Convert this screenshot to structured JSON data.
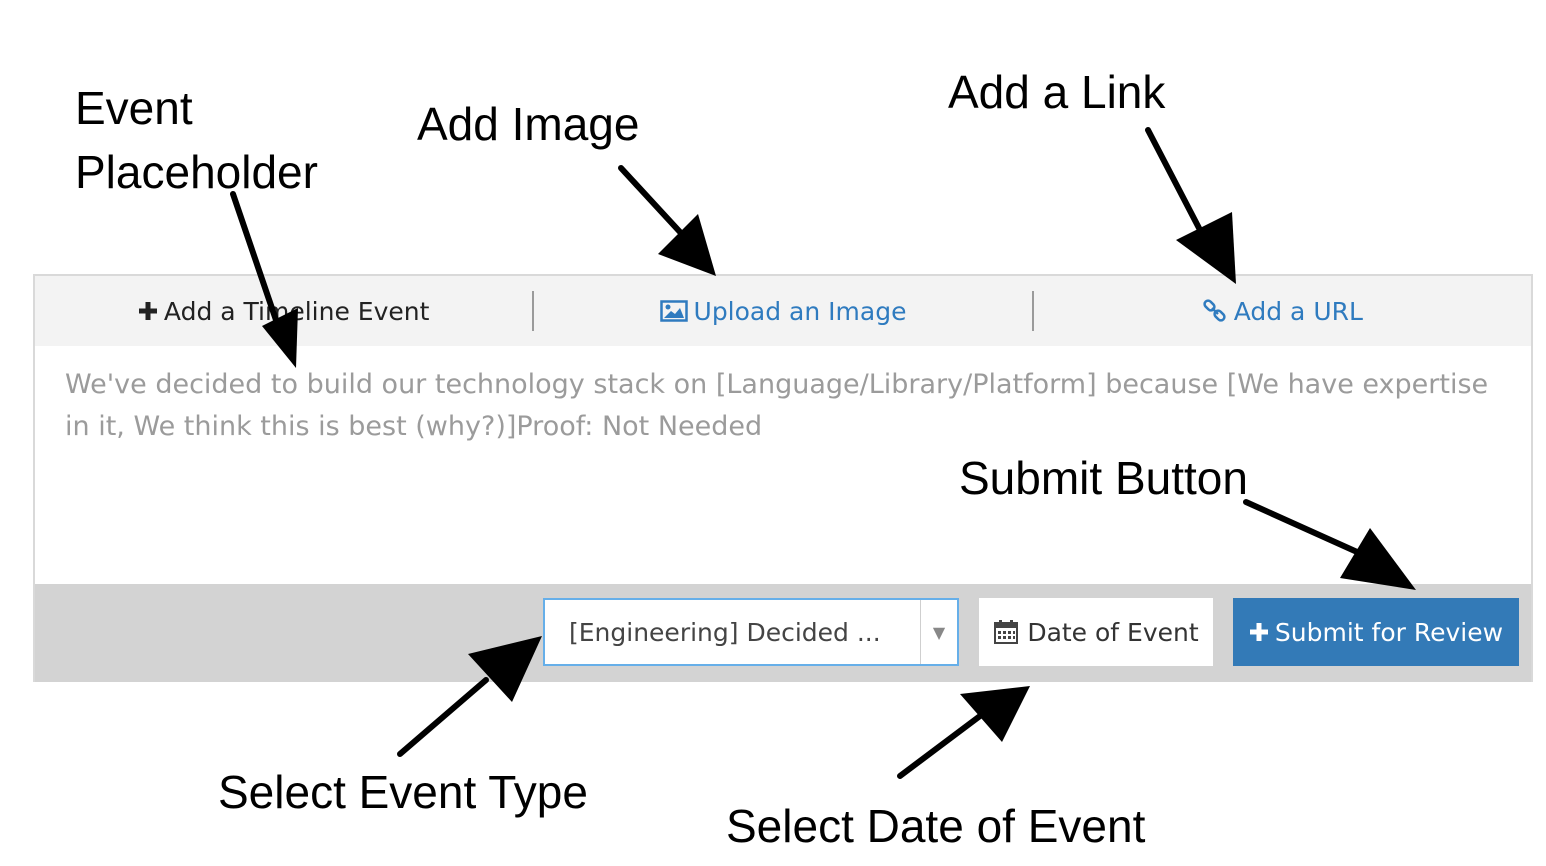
{
  "callouts": {
    "event_line1": "Event",
    "event_line2": "Placeholder",
    "add_image": "Add Image",
    "add_link": "Add a Link",
    "submit_button": "Submit Button",
    "select_event_type": "Select Event Type",
    "select_date": "Select Date of Event"
  },
  "tabs": {
    "timeline_label": "Add a Timeline Event",
    "image_label": "Upload an Image",
    "url_label": "Add a URL"
  },
  "editor": {
    "placeholder": "We've decided to build our technology stack on [Language/Library/Platform] because [We have expertise in it, We think this is best (why?)]Proof: Not Needed"
  },
  "footer": {
    "event_type_value": "[Engineering] Decided ...",
    "date_label": "Date of Event",
    "submit_label": "Submit for Review"
  },
  "colors": {
    "link_blue": "#2f7bbf",
    "submit_blue": "#337ab7",
    "focus_border": "#66afe9"
  },
  "icons": [
    "plus-icon",
    "image-icon",
    "link-icon",
    "calendar-icon",
    "chevron-down-icon"
  ]
}
